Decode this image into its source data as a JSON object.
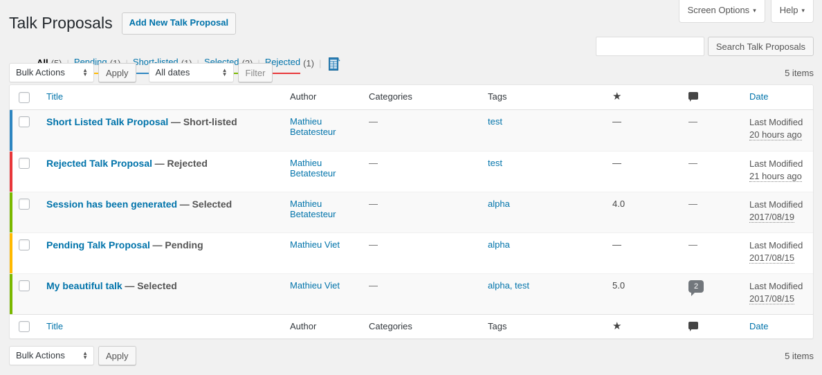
{
  "screen_meta": {
    "screen_options": "Screen Options",
    "help": "Help",
    "caret": "▾"
  },
  "header": {
    "title": "Talk Proposals",
    "add_new_label": "Add New Talk Proposal"
  },
  "filters": {
    "items": [
      {
        "label": "All",
        "count": "(5)",
        "current": true,
        "underline": ""
      },
      {
        "label": "Pending",
        "count": "(1)",
        "current": false,
        "underline": "u-pending"
      },
      {
        "label": "Short-listed",
        "count": "(1)",
        "current": false,
        "underline": "u-short"
      },
      {
        "label": "Selected",
        "count": "(2)",
        "current": false,
        "underline": "u-selected"
      },
      {
        "label": "Rejected",
        "count": "(1)",
        "current": false,
        "underline": "u-rejected"
      }
    ],
    "separator": "|",
    "export_icon": "spreadsheet-export-icon"
  },
  "search": {
    "value": "",
    "placeholder": "",
    "submit_label": "Search Talk Proposals"
  },
  "tablenav_top": {
    "bulk_actions_label": "Bulk Actions",
    "apply_label": "Apply",
    "dates_label": "All dates",
    "filter_label": "Filter",
    "items_count": "5 items"
  },
  "tablenav_bottom": {
    "bulk_actions_label": "Bulk Actions",
    "apply_label": "Apply",
    "items_count": "5 items"
  },
  "table": {
    "columns": {
      "title": "Title",
      "author": "Author",
      "categories": "Categories",
      "tags": "Tags",
      "rating": "★",
      "comments": "comment-icon",
      "date": "Date"
    },
    "rows": [
      {
        "title": "Short Listed Talk Proposal",
        "status_suffix": "— Short-listed",
        "author": "Mathieu Betatesteur",
        "categories": "—",
        "tags": "test",
        "rating": "—",
        "comments": "—",
        "comments_count": null,
        "date_label": "Last Modified",
        "date_value": "20 hours ago",
        "status_color": "#2e86c1",
        "status_name": "short-listed"
      },
      {
        "title": "Rejected Talk Proposal",
        "status_suffix": "— Rejected",
        "author": "Mathieu Betatesteur",
        "categories": "—",
        "tags": "test",
        "rating": "—",
        "comments": "—",
        "comments_count": null,
        "date_label": "Last Modified",
        "date_value": "21 hours ago",
        "status_color": "#e8373a",
        "status_name": "rejected"
      },
      {
        "title": "Session has been generated",
        "status_suffix": "— Selected",
        "author": "Mathieu Betatesteur",
        "categories": "—",
        "tags": "alpha",
        "rating": "4.0",
        "comments": "—",
        "comments_count": null,
        "date_label": "Last Modified",
        "date_value": "2017/08/19",
        "status_color": "#7ab800",
        "status_name": "selected"
      },
      {
        "title": "Pending Talk Proposal",
        "status_suffix": "— Pending",
        "author": "Mathieu Viet",
        "categories": "—",
        "tags": "alpha",
        "rating": "—",
        "comments": "—",
        "comments_count": null,
        "date_label": "Last Modified",
        "date_value": "2017/08/15",
        "status_color": "#ffb900",
        "status_name": "pending"
      },
      {
        "title": "My beautiful talk",
        "status_suffix": "— Selected",
        "author": "Mathieu Viet",
        "categories": "—",
        "tags": "alpha, test",
        "rating": "5.0",
        "comments": "",
        "comments_count": "2",
        "date_label": "Last Modified",
        "date_value": "2017/08/15",
        "status_color": "#7ab800",
        "status_name": "selected"
      }
    ]
  },
  "colors": {
    "link": "#0073aa",
    "page_bg": "#f1f1f1",
    "row_alt_bg": "#f9f9f9",
    "comment_bubble": "#72777c"
  }
}
